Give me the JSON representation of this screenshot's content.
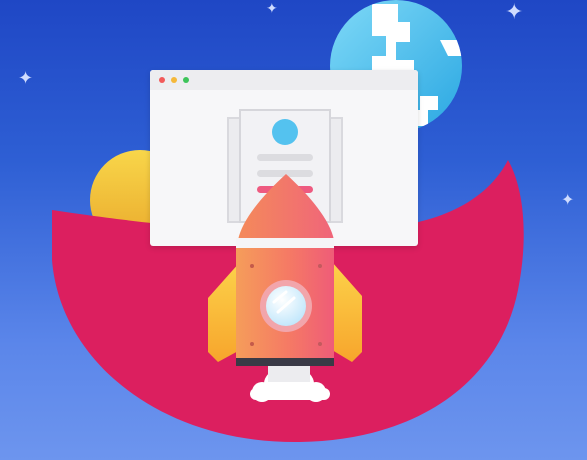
{
  "illustration": {
    "subject": "rocket-launch",
    "colors": {
      "sky_top": "#1f47c5",
      "sky_bottom": "#6d95ee",
      "blob": "#dc1f5f",
      "sun": "#f5c531",
      "planet": "#4ec3ef",
      "rocket_body": "#f47d5e",
      "rocket_fin": "#fbb638",
      "window_ring": "#f0a0a8",
      "browser_frame": "#f7f7f9"
    },
    "browser_dots": [
      "#f25a5a",
      "#f5b83a",
      "#3dc45a"
    ]
  }
}
